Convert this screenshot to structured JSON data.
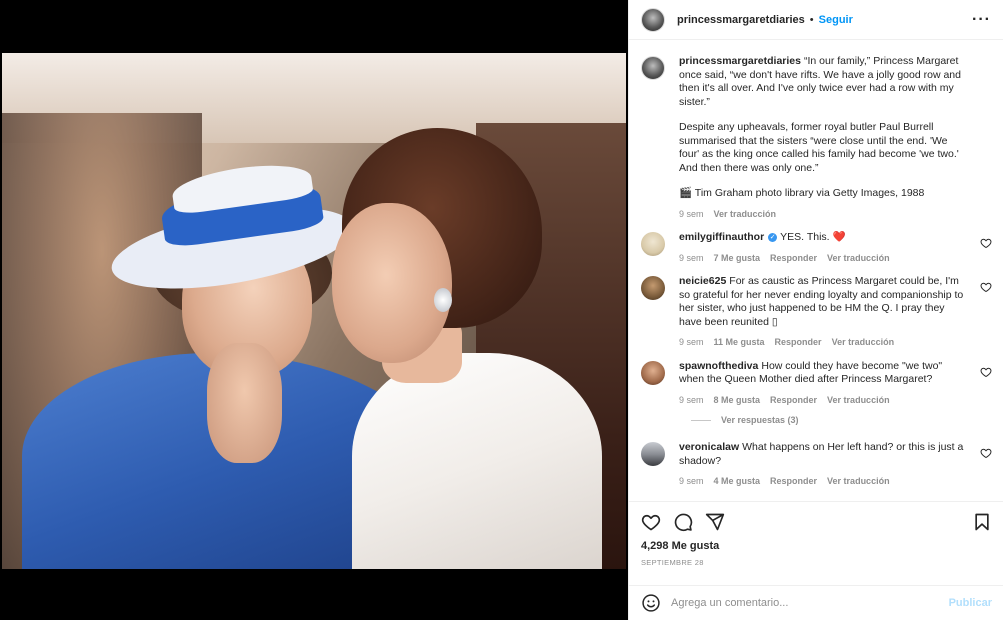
{
  "post": {
    "username": "princessmargaretdiaries",
    "follow_label": "Seguir",
    "separator": "•",
    "more_label": "···"
  },
  "caption": {
    "username": "princessmargaretdiaries",
    "paragraphs": [
      "“In our family,” Princess Margaret once said, “we don't have rifts. We have a jolly good row and then it's all over. And I've only twice ever had a row with my sister.”",
      "Despite any upheavals, former royal butler Paul Burrell summarised that the sisters “were close until the end. 'We four' as the king once called his family had become 'we two.' And then there was only one.”",
      "🎬 Tim Graham photo library via Getty Images, 1988"
    ],
    "time": "9 sem",
    "translate": "Ver traducción"
  },
  "comments": [
    {
      "username": "emilygiffinauthor",
      "verified": true,
      "text": "YES. This.",
      "emoji": "❤️",
      "time": "9 sem",
      "likes": "7 Me gusta",
      "reply": "Responder",
      "translate": "Ver traducción",
      "avatar_color": "#d8c9a8"
    },
    {
      "username": "neicie625",
      "verified": false,
      "text": "For as caustic as Princess Margaret could be, I'm so grateful for her never ending loyalty and companionship to her sister, who just happened to be HM the Q. I pray they have been reunited ▯",
      "time": "9 sem",
      "likes": "11 Me gusta",
      "reply": "Responder",
      "translate": "Ver traducción",
      "avatar_color": "#7a5b3a"
    },
    {
      "username": "spawnofthediva",
      "verified": false,
      "text": "How could they have become \"we two\" when the Queen Mother died after Princess Margaret?",
      "time": "9 sem",
      "likes": "8 Me gusta",
      "reply": "Responder",
      "translate": "Ver traducción",
      "avatar_color": "#a06a4a",
      "replies": "Ver respuestas (3)"
    },
    {
      "username": "veronicalaw",
      "verified": false,
      "text": "What happens on Her left hand?  or this is just a shadow?",
      "time": "9 sem",
      "likes": "4 Me gusta",
      "reply": "Responder",
      "translate": "Ver traducción",
      "avatar_color": "#8c8f96"
    }
  ],
  "stats": {
    "likes": "4,298 Me gusta",
    "date": "SEPTIEMBRE 28"
  },
  "add_comment": {
    "placeholder": "Agrega un comentario...",
    "publish_label": "Publicar"
  },
  "icons": {
    "like": "heart-icon",
    "comment": "comment-icon",
    "share": "share-icon",
    "save": "bookmark-icon",
    "emoji": "emoji-icon",
    "more": "more-icon"
  },
  "colors": {
    "accent": "#0095f6",
    "publish_disabled": "#b2dffc",
    "muted": "#8e8e8e",
    "heart_red": "#ed4956"
  }
}
